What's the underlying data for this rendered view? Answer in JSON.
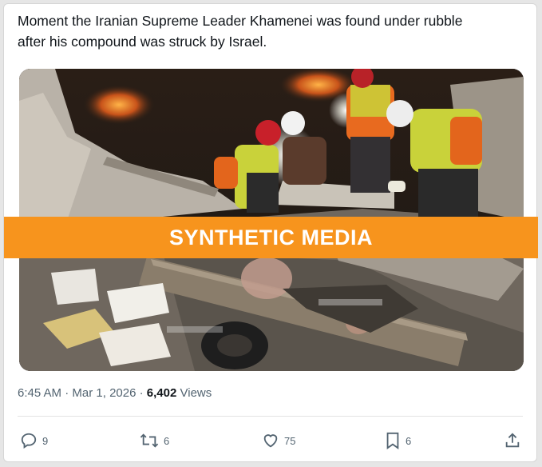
{
  "post": {
    "text_line1": "Moment the Iranian Supreme Leader Khamenei was found under rubble",
    "text_line2": "after his compound was struck by Israel."
  },
  "overlay": {
    "label": "SYNTHETIC MEDIA",
    "color": "#f7941d"
  },
  "meta": {
    "time": "6:45 AM",
    "date": "Mar 1, 2026",
    "views_count": "6,402",
    "views_label": "Views"
  },
  "actions": {
    "replies": "9",
    "reposts": "6",
    "likes": "75",
    "bookmarks": "6"
  }
}
